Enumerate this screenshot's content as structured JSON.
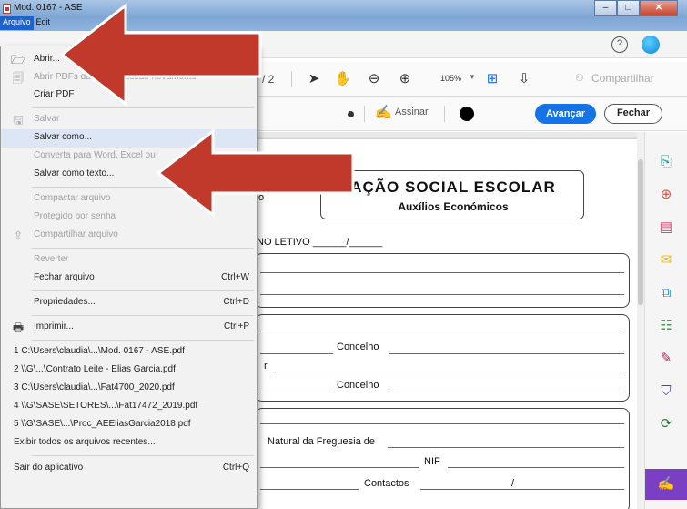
{
  "window": {
    "title": "Mod. 0167 - ASE",
    "controls": {
      "minimize": "–",
      "maximize": "□",
      "close": "✕"
    }
  },
  "menubar": {
    "items": [
      "Arquivo",
      "Edit"
    ]
  },
  "toolbar": {
    "page_count": "/ 2",
    "zoom": "105%",
    "share_label": "Compartilhar"
  },
  "fill_sign_bar": {
    "sign_label": "Assinar",
    "next_label": "Avançar",
    "close_label": "Fechar"
  },
  "document": {
    "title": "AÇÃO SOCIAL ESCOLAR",
    "subtitle": "Auxílios Económicos",
    "left_fragment": "o",
    "ano_letivo": "NO LETIVO ______/______",
    "concelho_1": "Concelho",
    "letter_r": "r",
    "concelho_2": "Concelho",
    "natural": "Natural da Freguesia de",
    "nif": "NIF",
    "contactos": "Contactos",
    "slash": "/"
  },
  "file_menu": {
    "items": [
      {
        "label": "Abrir...",
        "shortcut": "",
        "disabled": false,
        "icon": "folder-open-icon"
      },
      {
        "label": "Abrir PDFs da última sessão novamente",
        "shortcut": "",
        "disabled": true,
        "icon": "reopen-icon"
      },
      {
        "label": "Criar PDF",
        "shortcut": "",
        "disabled": false,
        "icon": ""
      },
      {
        "label": "Salvar",
        "shortcut": "",
        "disabled": true,
        "icon": "save-icon"
      },
      {
        "label": "Salvar como...",
        "shortcut": "",
        "disabled": false,
        "icon": ""
      },
      {
        "label": "Converta para Word, Excel ou",
        "shortcut": "",
        "disabled": true,
        "icon": ""
      },
      {
        "label": "Salvar como texto...",
        "shortcut": "",
        "disabled": false,
        "icon": ""
      },
      {
        "label": "Compactar arquivo",
        "shortcut": "",
        "disabled": true,
        "icon": ""
      },
      {
        "label": "Protegido por senha",
        "shortcut": "",
        "disabled": true,
        "icon": ""
      },
      {
        "label": "Compartilhar arquivo",
        "shortcut": "",
        "disabled": true,
        "icon": "share-icon"
      },
      {
        "label": "Reverter",
        "shortcut": "",
        "disabled": true,
        "icon": ""
      },
      {
        "label": "Fechar arquivo",
        "shortcut": "Ctrl+W",
        "disabled": false,
        "icon": ""
      },
      {
        "label": "Propriedades...",
        "shortcut": "Ctrl+D",
        "disabled": false,
        "icon": ""
      },
      {
        "label": "Imprimir...",
        "shortcut": "Ctrl+P",
        "disabled": false,
        "icon": "printer-icon"
      },
      {
        "label": "1 C:\\Users\\claudia\\...\\Mod. 0167 - ASE.pdf",
        "shortcut": "",
        "disabled": false,
        "icon": ""
      },
      {
        "label": "2 \\\\G\\...\\Contrato Leite - Elias Garcia.pdf",
        "shortcut": "",
        "disabled": false,
        "icon": ""
      },
      {
        "label": "3 C:\\Users\\claudia\\...\\Fat4700_2020.pdf",
        "shortcut": "",
        "disabled": false,
        "icon": ""
      },
      {
        "label": "4 \\\\G\\SASE\\SETORES\\...\\Fat17472_2019.pdf",
        "shortcut": "",
        "disabled": false,
        "icon": ""
      },
      {
        "label": "5 \\\\G\\SASE\\...\\Proc_AEEliasGarcia2018.pdf",
        "shortcut": "",
        "disabled": false,
        "icon": ""
      },
      {
        "label": "Exibir todos os arquivos recentes...",
        "shortcut": "",
        "disabled": false,
        "icon": ""
      },
      {
        "label": "Sair do aplicativo",
        "shortcut": "Ctrl+Q",
        "disabled": false,
        "icon": ""
      }
    ]
  },
  "colors": {
    "arrow_red": "#c0392b",
    "accent_blue": "#1473e6",
    "menu_highlight": "#dce6f4",
    "active_tool_purple": "#7b3fc4"
  }
}
